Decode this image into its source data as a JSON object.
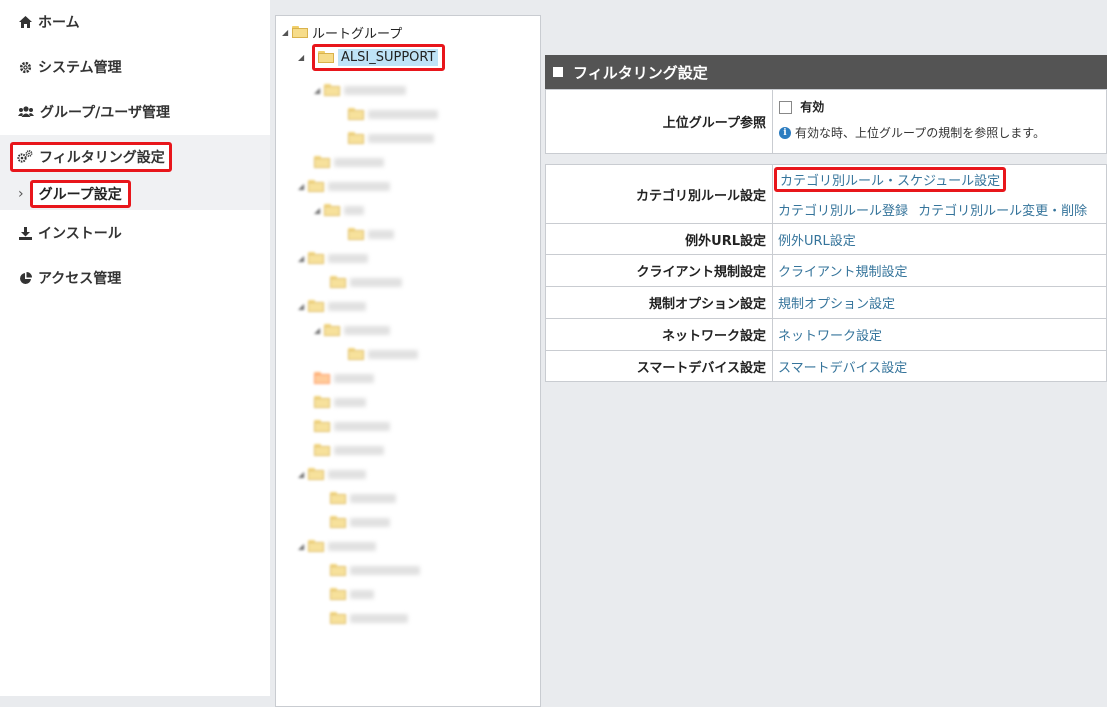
{
  "sidebar": {
    "items": [
      {
        "label": "ホーム",
        "icon": "home-icon"
      },
      {
        "label": "システム管理",
        "icon": "gear-icon"
      },
      {
        "label": "グループ/ユーザ管理",
        "icon": "users-icon"
      },
      {
        "label": "フィルタリング設定",
        "icon": "gears-icon"
      },
      {
        "label": "インストール",
        "icon": "download-icon"
      },
      {
        "label": "アクセス管理",
        "icon": "pie-chart-icon"
      }
    ],
    "sub_item": {
      "label": "グループ設定",
      "chevron": "›"
    }
  },
  "tree": {
    "root": "ルートグループ",
    "selected": "ALSI_SUPPORT"
  },
  "main": {
    "section_title": "フィルタリング設定",
    "upper_group": {
      "label": "上位グループ参照",
      "checkbox_label": "有効",
      "info": "有効な時、上位グループの規制を参照します。"
    },
    "rows": [
      {
        "label": "カテゴリ別ルール設定",
        "links": [
          "カテゴリ別ルール・スケジュール設定",
          "カテゴリ別ルール登録",
          "カテゴリ別ルール変更・削除"
        ]
      },
      {
        "label": "例外URL設定",
        "links": [
          "例外URL設定"
        ]
      },
      {
        "label": "クライアント規制設定",
        "links": [
          "クライアント規制設定"
        ]
      },
      {
        "label": "規制オプション設定",
        "links": [
          "規制オプション設定"
        ]
      },
      {
        "label": "ネットワーク設定",
        "links": [
          "ネットワーク設定"
        ]
      },
      {
        "label": "スマートデバイス設定",
        "links": [
          "スマートデバイス設定"
        ]
      }
    ]
  },
  "colors": {
    "highlight_border": "#e8161b",
    "header_bg": "#545454",
    "link": "#35749b",
    "selection": "#bfe3f7"
  }
}
